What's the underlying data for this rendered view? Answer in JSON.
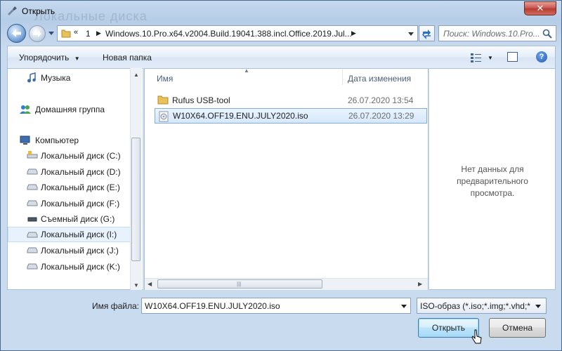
{
  "window": {
    "title": "Открыть",
    "background_title": "Локальные диска",
    "close_label": "✕"
  },
  "address": {
    "chevron": "«",
    "segments": [
      "1",
      "Windows.10.Pro.x64.v2004.Build.19041.388.incl.Office.2019.Jul..."
    ],
    "search_placeholder": "Поиск: Windows.10.Pro..."
  },
  "toolbar": {
    "organize_label": "Упорядочить",
    "new_folder_label": "Новая папка",
    "help_label": "?"
  },
  "nav": {
    "items": [
      {
        "label": "Музыка",
        "icon": "music-icon",
        "selected": false
      },
      {
        "label": "Домашняя группа",
        "icon": "homegroup-icon",
        "selected": false
      },
      {
        "label": "Компьютер",
        "icon": "computer-icon",
        "selected": false
      },
      {
        "label": "Локальный диск (C:)",
        "icon": "system-drive-icon",
        "selected": false
      },
      {
        "label": "Локальный диск (D:)",
        "icon": "drive-icon",
        "selected": false
      },
      {
        "label": "Локальный диск (E:)",
        "icon": "drive-icon",
        "selected": false
      },
      {
        "label": "Локальный диск (F:)",
        "icon": "drive-icon",
        "selected": false
      },
      {
        "label": "Съемный диск (G:)",
        "icon": "removable-drive-icon",
        "selected": false
      },
      {
        "label": "Локальный диск (I:)",
        "icon": "drive-icon",
        "selected": true
      },
      {
        "label": "Локальный диск (J:)",
        "icon": "drive-icon",
        "selected": false
      },
      {
        "label": "Локальный диск (K:)",
        "icon": "drive-icon",
        "selected": false
      }
    ]
  },
  "list": {
    "columns": {
      "name": "Имя",
      "date": "Дата изменения"
    },
    "rows": [
      {
        "name": "Rufus USB-tool",
        "date": "26.07.2020 13:54",
        "icon": "folder-icon",
        "selected": false
      },
      {
        "name": "W10X64.OFF19.ENU.JULY2020.iso",
        "date": "26.07.2020 13:29",
        "icon": "iso-file-icon",
        "selected": true
      }
    ]
  },
  "preview": {
    "text": "Нет данных для предварительного просмотра."
  },
  "footer": {
    "filename_label": "Имя файла:",
    "filename_value": "W10X64.OFF19.ENU.JULY2020.iso",
    "filetype_value": "ISO-образ (*.iso;*.img;*.vhd;*",
    "open_label": "Открыть",
    "cancel_label": "Отмена"
  },
  "colors": {
    "accent": "#3c7fb1",
    "selection": "#d5e8fb",
    "close": "#c75050"
  }
}
